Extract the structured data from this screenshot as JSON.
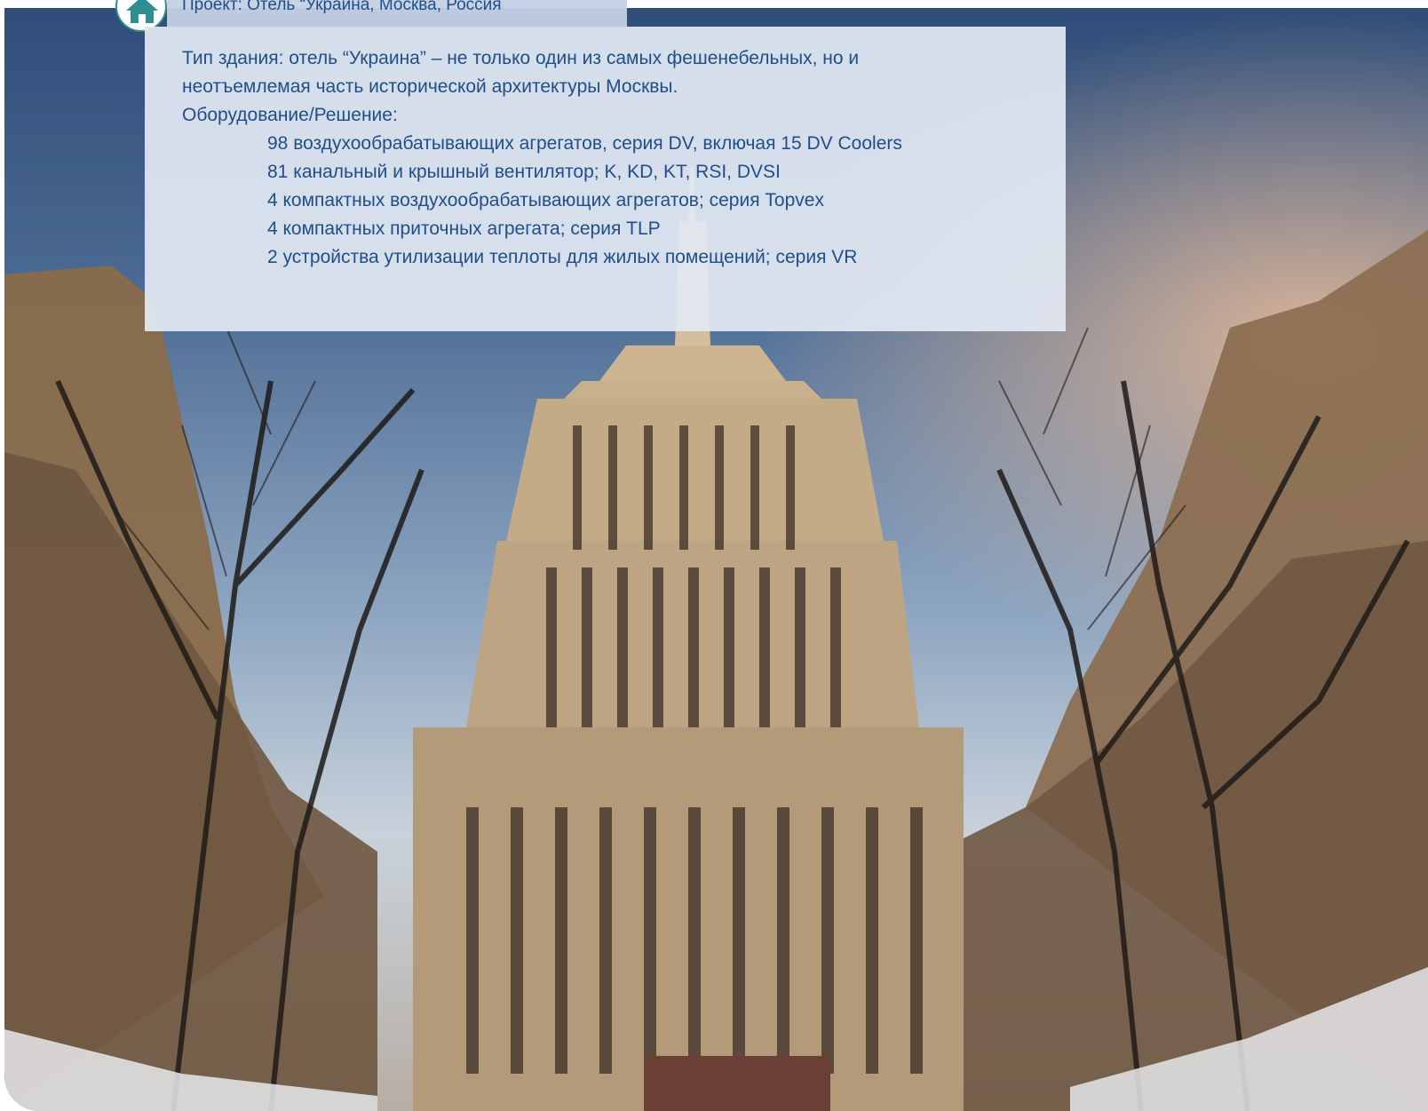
{
  "project_title": "Проект: Отель “Украина, Москва, Россия",
  "building_type_line1": "Тип здания: отель “Украина” – не только один из самых фешенебельных, но и",
  "building_type_line2": "неотъемлемая часть исторической архитектуры Москвы.",
  "equipment_heading": "Оборудование/Решение:",
  "equipment_items": [
    "98 воздухообрабатывающих агрегатов, серия DV, включая 15 DV Coolers",
    "81 канальный и крышный вентилятор; K, KD, KT, RSI, DVSI",
    "4 компактных воздухообрабатывающих агрегатов; серия Topvex",
    "4 компактных приточных агрегата; серия TLP",
    "2 устройства утилизации теплоты для жилых помещений; серия VR"
  ],
  "icons": {
    "home": "home-icon"
  },
  "colors": {
    "text": "#1f4e8c",
    "accent": "#2d8f8e",
    "panel": "#e2e8f3"
  }
}
